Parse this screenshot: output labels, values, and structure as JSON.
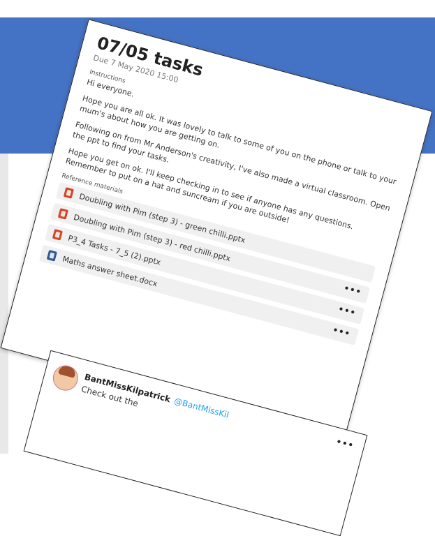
{
  "assignment": {
    "title": "07/05 tasks",
    "due": "Due 7 May 2020 15:00",
    "instructions_label": "Instructions",
    "paragraphs": [
      "Hi everyone.",
      "Hope you are all ok. It was lovely to talk to some of you on the phone or talk to your mum's about how you are getting on.",
      "Following on from Mr Anderson's creativity, I've also made a virtual classroom. Open the ppt to find your tasks.",
      "Hope you get on ok. I'll keep checking in to see if anyone has any questions. Remember to put on a hat and suncream if you are outside!"
    ],
    "reference_label": "Reference materials",
    "attachments": [
      {
        "name": "Doubling with Pim (step 3) - green chilli.pptx",
        "type": "pptx"
      },
      {
        "name": "Doubling with Pim (step 3) - red chilli.pptx",
        "type": "pptx"
      },
      {
        "name": "P3_4 Tasks - 7_5 (2).pptx",
        "type": "pptx"
      },
      {
        "name": "Maths answer sheet.docx",
        "type": "docx"
      }
    ],
    "more_label": "•••"
  },
  "tweet": {
    "username": "BantMissKilpatrick",
    "handle": "@BantMissKil",
    "text": "Check out the",
    "more_label": "•••"
  },
  "colors": {
    "header_band": "#4472c4",
    "ppt_icon": "#d24726",
    "docx_icon": "#2b579a"
  }
}
